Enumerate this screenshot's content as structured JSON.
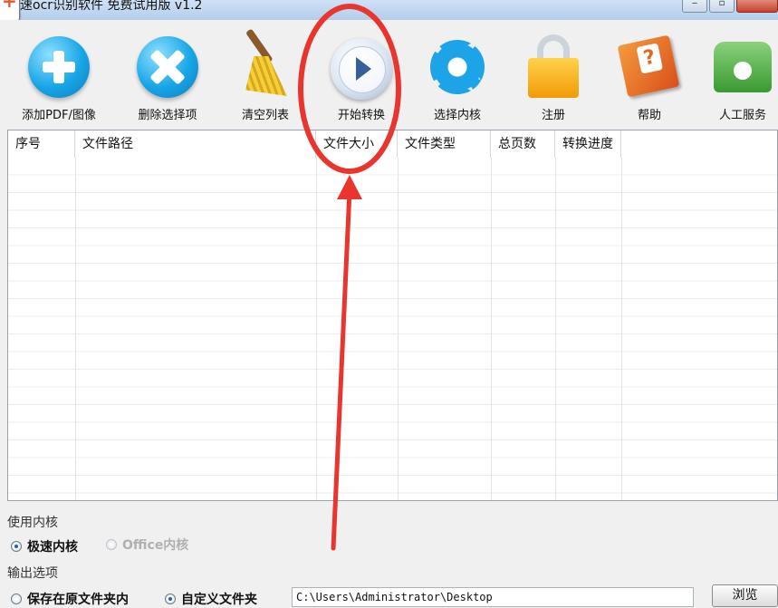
{
  "window": {
    "title": "速ocr识别软件 免费试用版 v1.2"
  },
  "toolbar": {
    "buttons": [
      {
        "label": "添加PDF/图像",
        "icon": "add-icon"
      },
      {
        "label": "删除选择项",
        "icon": "delete-icon"
      },
      {
        "label": "清空列表",
        "icon": "broom-icon"
      },
      {
        "label": "开始转换",
        "icon": "play-icon"
      },
      {
        "label": "选择内核",
        "icon": "gear-icon"
      },
      {
        "label": "注册",
        "icon": "lock-icon"
      },
      {
        "label": "帮助",
        "icon": "help-book-icon"
      },
      {
        "label": "人工服务",
        "icon": "phone-icon"
      }
    ]
  },
  "table": {
    "columns": [
      "序号",
      "文件路径",
      "文件大小",
      "文件类型",
      "总页数",
      "转换进度"
    ],
    "rows": []
  },
  "engine": {
    "section_title": "使用内核",
    "options": [
      {
        "label": "极速内核",
        "selected": true,
        "enabled": true
      },
      {
        "label": "Office内核",
        "selected": false,
        "enabled": false
      }
    ]
  },
  "output": {
    "section_title": "输出选项",
    "options": [
      {
        "label": "保存在原文件夹内",
        "selected": false
      },
      {
        "label": "自定义文件夹",
        "selected": true
      }
    ],
    "path": "C:\\Users\\Administrator\\Desktop",
    "browse_label": "浏览"
  },
  "colors": {
    "annotation_red": "#e8352e",
    "accent_blue": "#18a6e6"
  }
}
